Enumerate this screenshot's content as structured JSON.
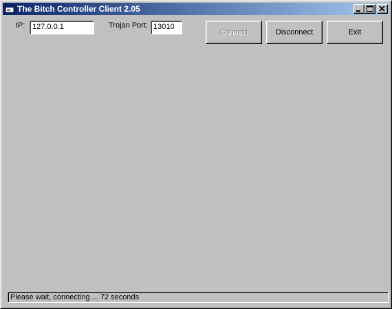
{
  "window": {
    "title": "The Bitch Controller Client 2.05",
    "titlebar_color_start": "#0a246a",
    "titlebar_color_end": "#a6caf0",
    "background": "#c0c0c0"
  },
  "connection": {
    "ip_label": "IP:",
    "ip_value": "127.0.0.1",
    "port_label": "Trojan Port:",
    "port_value": "13010"
  },
  "buttons": {
    "connect": "Connect",
    "connect_enabled": false,
    "disconnect": "Disconnect",
    "exit": "Exit"
  },
  "status": {
    "text": "Please wait, connecting ... 72 seconds"
  },
  "icons": {
    "app": "app-window-icon",
    "minimize": "minimize-icon",
    "maximize": "maximize-icon",
    "close": "close-icon"
  }
}
